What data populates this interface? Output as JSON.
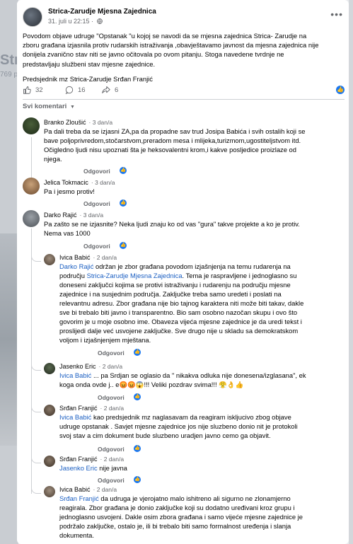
{
  "background": {
    "ghost_title": "Stri",
    "ghost_sub": "769 p"
  },
  "post": {
    "page_name": "Strica-Zarudje Mjesna Zajednica",
    "timestamp": "31. juli u 22:15 ·",
    "paragraph1_lines": [
      "Povodom objave udruge \"Opstanak \"u kojoj se navodi da se mjesna zajednica Strica- Zarudje na",
      "zboru građana izjasnila protiv rudarskih istraživanja ,obavještavamo javnost da mjesna zajednica nije",
      "donijela zvanično stav niti se javno očitovala po ovom pitanju. Stoga navedene tvrdnje ne",
      "predstavljaju službeni stav mjesne zajednice."
    ],
    "signature": "Predsjednik mz Strica-Zarudje Srđan Franjić",
    "likes": "32",
    "comments": "16",
    "shares": "6"
  },
  "sort_label": "Svi komentari",
  "reply_label": "Odgovori",
  "comments": [
    {
      "name": "Branko Zloušić",
      "time": "3 dan/a",
      "lines": [
        "Pa dali treba da se izjasni ZA,pa da propadne sav trud Josipa Babića i svih ostalih koji se",
        "bave poljoprivredom,stočarstvom,preradom mesa i mlijeka,turizmom,ugostiteljstvom itd.",
        "Očigledno ljudi nisu upoznati šta je heksovalentni krom,i kakve posljedice proizlaze od",
        "njega."
      ]
    },
    {
      "name": "Jelica Tokmacic",
      "time": "3 dan/a",
      "lines": [
        "Pa i jesmo protiv!"
      ]
    },
    {
      "name": "Darko Rajić",
      "time": "3 dan/a",
      "lines": [
        "Pa zašto se ne izjasnite? Neka ljudi znaju ko od vas \"gura\" takve projekte a ko je protiv.",
        "Nema vas 1000"
      ]
    }
  ],
  "replies": [
    {
      "name": "Ivica Babić",
      "time": "2 dan/a",
      "mention": "Darko Rajić",
      "lines": [
        " održan je zbor građana povodom izjašnjenja na temu rudarenja na",
        "području ",
        "Strica-Zarudje Mjesna Zajednica",
        ". Tema je raspravljene i jednoglasno su",
        "doneseni zaključci kojima se protivi istraživanju i rudarenju na području mjesne",
        "zajednice i na susjednim područja. Zaključke treba samo uredeti i poslati na",
        "relevantnu adresu. Zbor građana nije bio tajnog karaktera niti može biti takav, dakle",
        "sve bi trebalo biti javno i transparentno. Bio sam osobno nazočan skupu i ovo što",
        "govorim je u moje osobno ime. Obaveza vijeća mjesne zajednice je da uredi tekst i",
        "proslijedi dalje već usvojene zaključke. Sve drugo nije u skladu sa demokratskom",
        "voljom i izjašnjenjem mještana."
      ]
    },
    {
      "name": "Jasenko Eric",
      "time": "2 dan/a",
      "mention": "Ivica Babić",
      "lines": [
        " ... pa Srdjan se oglasio da \" nikakva odluka nije donesena/izglasana\", ek",
        "koga onda ovde j.. e😡😡😱!!! Veliki pozdrav svima!!! 😤👌👍"
      ]
    },
    {
      "name": "Srđan Franjić",
      "time": "2 dan/a",
      "mention": "Ivica Babić",
      "lines": [
        " kao predsjednik mz naglasavam da reagiram iskljucivo zbog objave",
        "udruge opstanak . Savjet mjesne zajednice jos nije sluzbeno donio nit je protokoli",
        "svoj stav a cim dokument bude sluzbeno uradjen javno cemo ga objavit."
      ]
    },
    {
      "name": "Srđan Franjić",
      "time": "2 dan/a",
      "mention": "Jasenko Eric",
      "lines": [
        " nije javna"
      ]
    },
    {
      "name": "Ivica Babić",
      "time": "2 dan/a",
      "mention": "Srđan Franjić",
      "lines": [
        " da udruga je vjerojatno malo ishitreno ali sigurno ne zlonamjerno",
        "reagirala. Zbor građana je donio zaključke koji su dodatno uređivani kroz grupu i",
        "jednoglasno usvojeni. Dakle osim zbora građana i samo vijeće mjesne zajednice je",
        "podržalo zaključke, ostalo je, ili bi trebalo biti samo formalnost uređenja i slanja",
        "dokumenta."
      ]
    }
  ],
  "colors": {
    "accent": "#1877f2",
    "mention": "#1a5ec2",
    "muted": "#65676b"
  }
}
